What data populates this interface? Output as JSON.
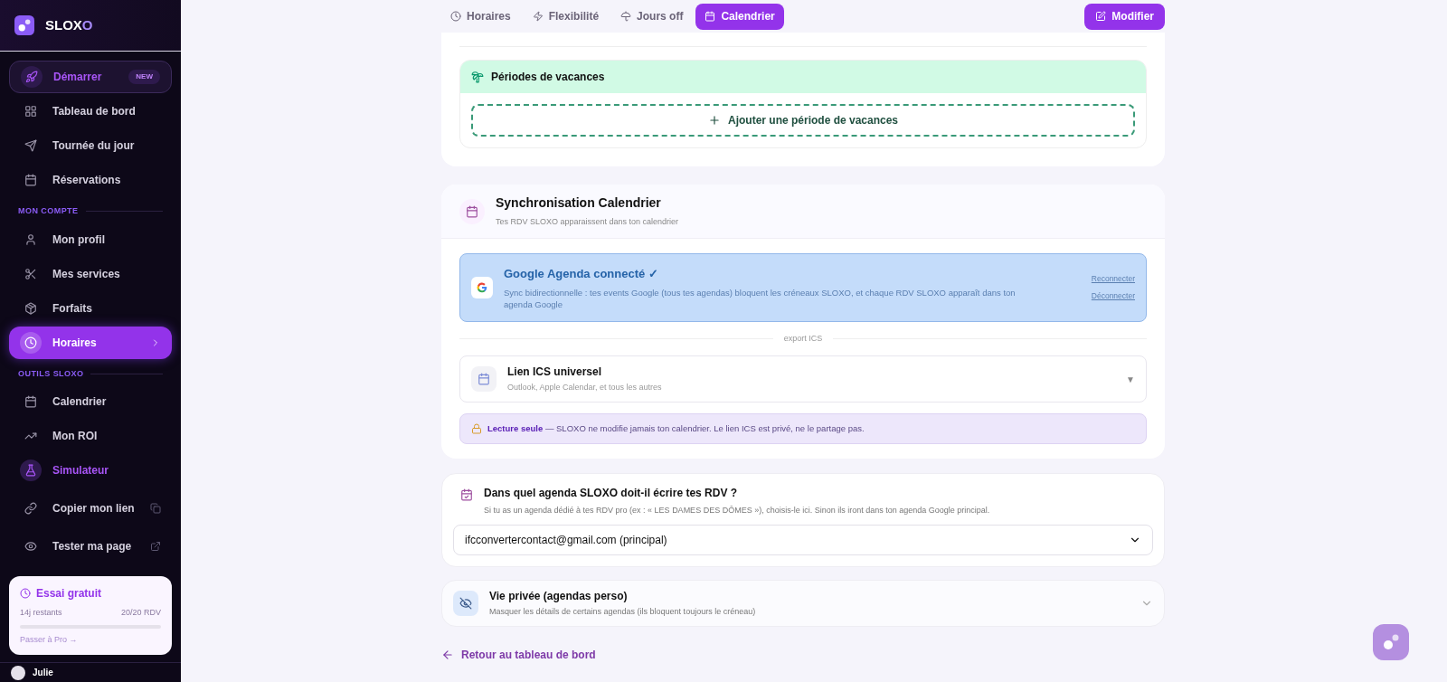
{
  "brand": {
    "name_main": "SLOX",
    "name_accent": "O"
  },
  "sidebar": {
    "items": [
      {
        "label": "Démarrer",
        "kind": "featured",
        "badge": "NEW",
        "selected": false
      },
      {
        "label": "Tableau de bord",
        "kind": "normal",
        "selected": false
      },
      {
        "label": "Tournée du jour",
        "kind": "normal",
        "selected": false
      },
      {
        "label": "Réservations",
        "kind": "normal",
        "selected": false
      },
      {
        "label": "MON COMPTE",
        "kind": "section"
      },
      {
        "label": "Mon profil",
        "kind": "normal",
        "selected": false
      },
      {
        "label": "Mes services",
        "kind": "normal",
        "selected": false
      },
      {
        "label": "Forfaits",
        "kind": "normal",
        "selected": false
      },
      {
        "label": "Horaires",
        "kind": "normal",
        "selected": true
      },
      {
        "label": "OUTILS SLOXO",
        "kind": "section"
      },
      {
        "label": "Calendrier",
        "kind": "normal",
        "selected": false
      },
      {
        "label": "Mon ROI",
        "kind": "normal",
        "selected": false
      },
      {
        "label": "Simulateur",
        "kind": "accent",
        "selected": false
      },
      {
        "label": "Copier mon lien",
        "kind": "action",
        "selected": false
      },
      {
        "label": "Tester ma page",
        "kind": "action",
        "selected": false
      }
    ],
    "trial": {
      "title": "Essai gratuit",
      "remaining": "14j restants",
      "count": "20/20 RDV",
      "level": 0,
      "link": "Passer à Pro →"
    },
    "user": {
      "name": "Julie"
    }
  },
  "tabs": [
    {
      "label": "Horaires",
      "selected": false
    },
    {
      "label": "Flexibilité",
      "selected": false
    },
    {
      "label": "Jours off",
      "selected": false
    },
    {
      "label": "Calendrier",
      "selected": true
    }
  ],
  "edit_button": "Modifier",
  "vacations": {
    "title": "Périodes de vacances",
    "add_button": "Ajouter une période de vacances"
  },
  "sync": {
    "title": "Synchronisation Calendrier",
    "subtitle": "Tes RDV SLOXO apparaissent dans ton calendrier",
    "google": {
      "title": "Google Agenda connecté ✓",
      "description": "Sync bidirectionnelle : tes events Google (tous tes agendas) bloquent les créneaux SLOXO, et chaque RDV SLOXO apparaît dans ton agenda Google",
      "links": [
        "Reconnecter",
        "Déconnecter"
      ]
    },
    "divider": "export ICS",
    "ics": {
      "title": "Lien ICS universel",
      "subtitle": "Outlook, Apple Calendar, et tous les autres",
      "toggle": "▼",
      "expanded": false
    },
    "notice": {
      "lead": "Lecture seule",
      "text": "— SLOXO ne modifie jamais ton calendrier. Le lien ICS est privé, ne le partage pas."
    }
  },
  "agenda": {
    "title": "Dans quel agenda SLOXO doit-il écrire tes RDV ?",
    "subtitle": "Si tu as un agenda dédié à tes RDV pro (ex : « LES DAMES DES DÔMES »), choisis-le ici. Sinon ils iront dans ton agenda Google principal.",
    "value": "ifcconvertercontact@gmail.com (principal)"
  },
  "privacy": {
    "title": "Vie privée (agendas perso)",
    "subtitle": "Masquer les détails de certains agendas (ils bloquent toujours le créneau)",
    "expanded": false
  },
  "back_link": "Retour au tableau de bord"
}
